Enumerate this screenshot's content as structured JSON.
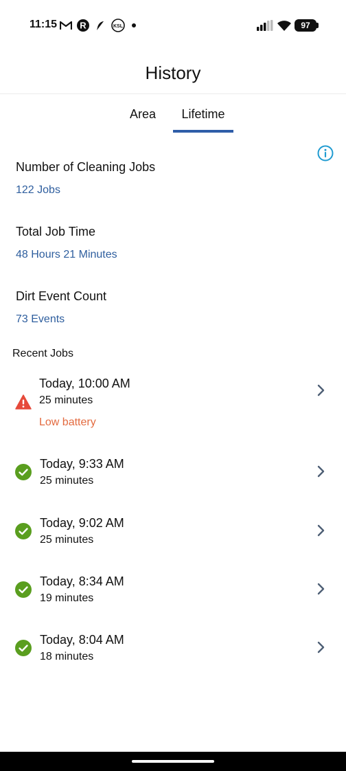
{
  "status_bar": {
    "time": "11:15",
    "icons": [
      "gmail-icon",
      "r-app-icon",
      "feather-icon",
      "ksl-icon",
      "dot-icon",
      "signal-icon",
      "wifi-icon"
    ],
    "ksl_text": "KSL",
    "battery": "97"
  },
  "header": {
    "title": "History"
  },
  "tabs": [
    {
      "label": "Area",
      "active": false
    },
    {
      "label": "Lifetime",
      "active": true
    }
  ],
  "stats": [
    {
      "label": "Number of Cleaning Jobs",
      "value": "122 Jobs"
    },
    {
      "label": "Total Job Time",
      "value": "48 Hours 21 Minutes"
    },
    {
      "label": "Dirt Event Count",
      "value": "73 Events"
    }
  ],
  "recent_jobs": {
    "title": "Recent Jobs",
    "items": [
      {
        "time": "Today, 10:00 AM",
        "duration": "25 minutes",
        "status": "warning",
        "note": "Low battery"
      },
      {
        "time": "Today, 9:33 AM",
        "duration": "25 minutes",
        "status": "success"
      },
      {
        "time": "Today, 9:02 AM",
        "duration": "25 minutes",
        "status": "success"
      },
      {
        "time": "Today, 8:34 AM",
        "duration": "19 minutes",
        "status": "success"
      },
      {
        "time": "Today, 8:04 AM",
        "duration": "18 minutes",
        "status": "success"
      }
    ]
  },
  "colors": {
    "accent": "#2f5da8",
    "link_text": "#2e5e9e",
    "success": "#5a9e1f",
    "warning": "#e64a3b",
    "warning_text": "#e36a3f",
    "info": "#1f9bd1",
    "chevron": "#4e5f75"
  }
}
